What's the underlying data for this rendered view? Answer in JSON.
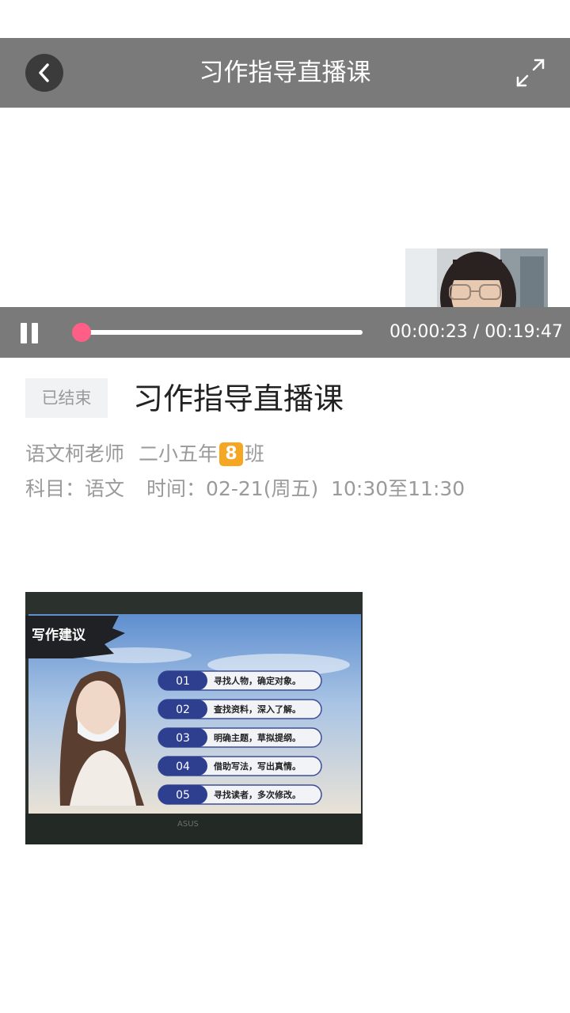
{
  "header": {
    "title": "习作指导直播课",
    "back_icon": "chevron-left-icon",
    "fullscreen_icon": "fullscreen-expand-icon"
  },
  "player": {
    "current_time": "00:00:23",
    "total_time": "00:19:47",
    "time_display": "00:00:23 / 00:19:47",
    "progress_fraction": 0.02,
    "accent_color": "#ff5f86"
  },
  "lesson": {
    "status": "已结束",
    "title": "习作指导直播课",
    "teacher": "语文柯老师",
    "class_prefix": "二小五年",
    "class_number": "8",
    "class_suffix": "班",
    "subject_label": "科目：",
    "subject": "语文",
    "time_label": "时间：",
    "time_value": "02-21(周五)  10:30至11:30"
  },
  "slide": {
    "heading": "写作建议",
    "items": [
      {
        "num": "01",
        "text": "寻找人物，确定对象。"
      },
      {
        "num": "02",
        "text": "查找资料，深入了解。"
      },
      {
        "num": "03",
        "text": "明确主题，草拟提纲。"
      },
      {
        "num": "04",
        "text": "借助写法，写出真情。"
      },
      {
        "num": "05",
        "text": "寻找读者，多次修改。"
      }
    ],
    "brand": "ASUS"
  }
}
